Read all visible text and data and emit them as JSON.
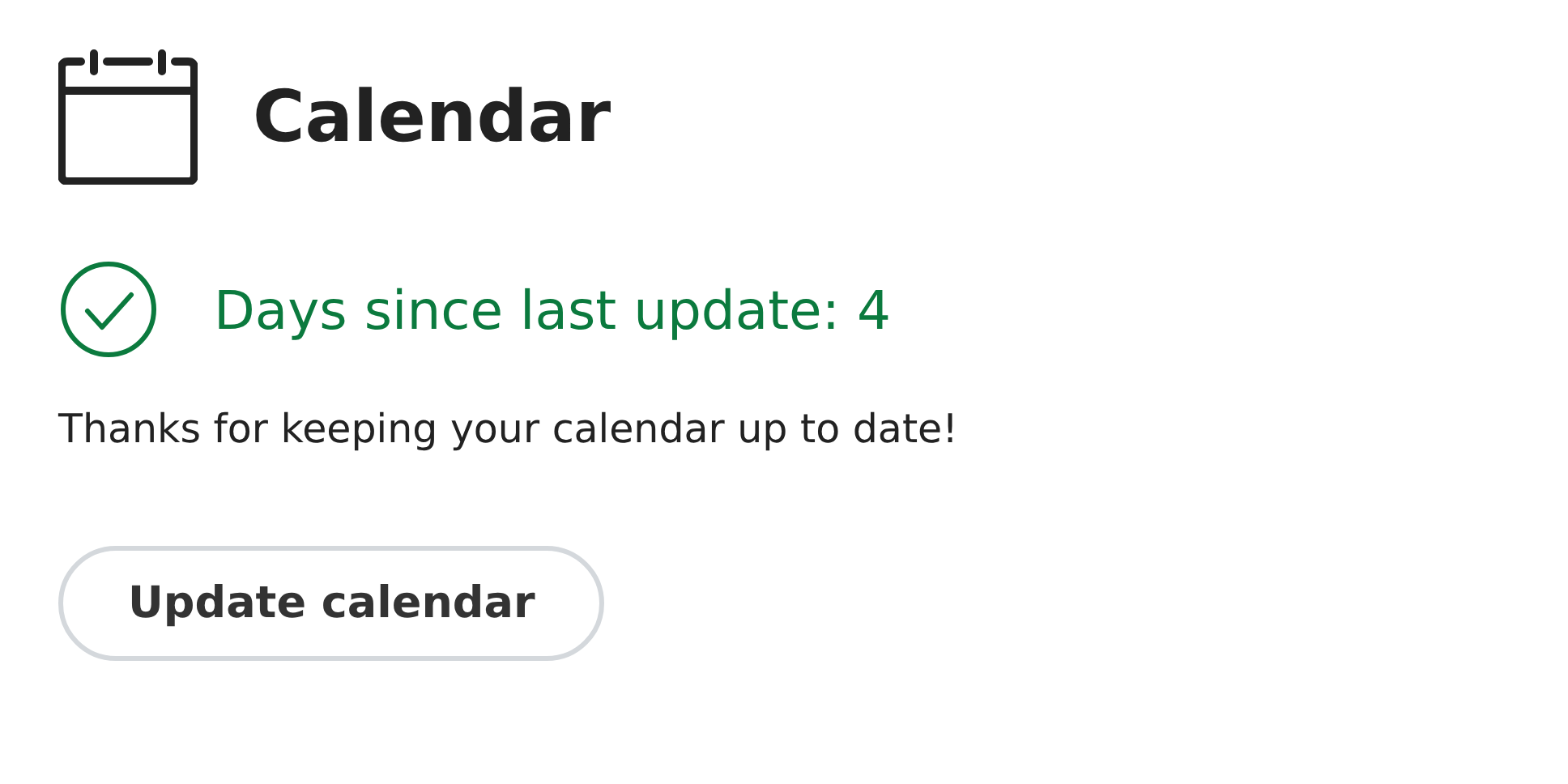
{
  "header": {
    "title": "Calendar"
  },
  "status": {
    "kind": "ok",
    "text": "Days since last update: 4"
  },
  "message": "Thanks for keeping your calendar up to date!",
  "buttons": [
    "Update calendar"
  ]
}
